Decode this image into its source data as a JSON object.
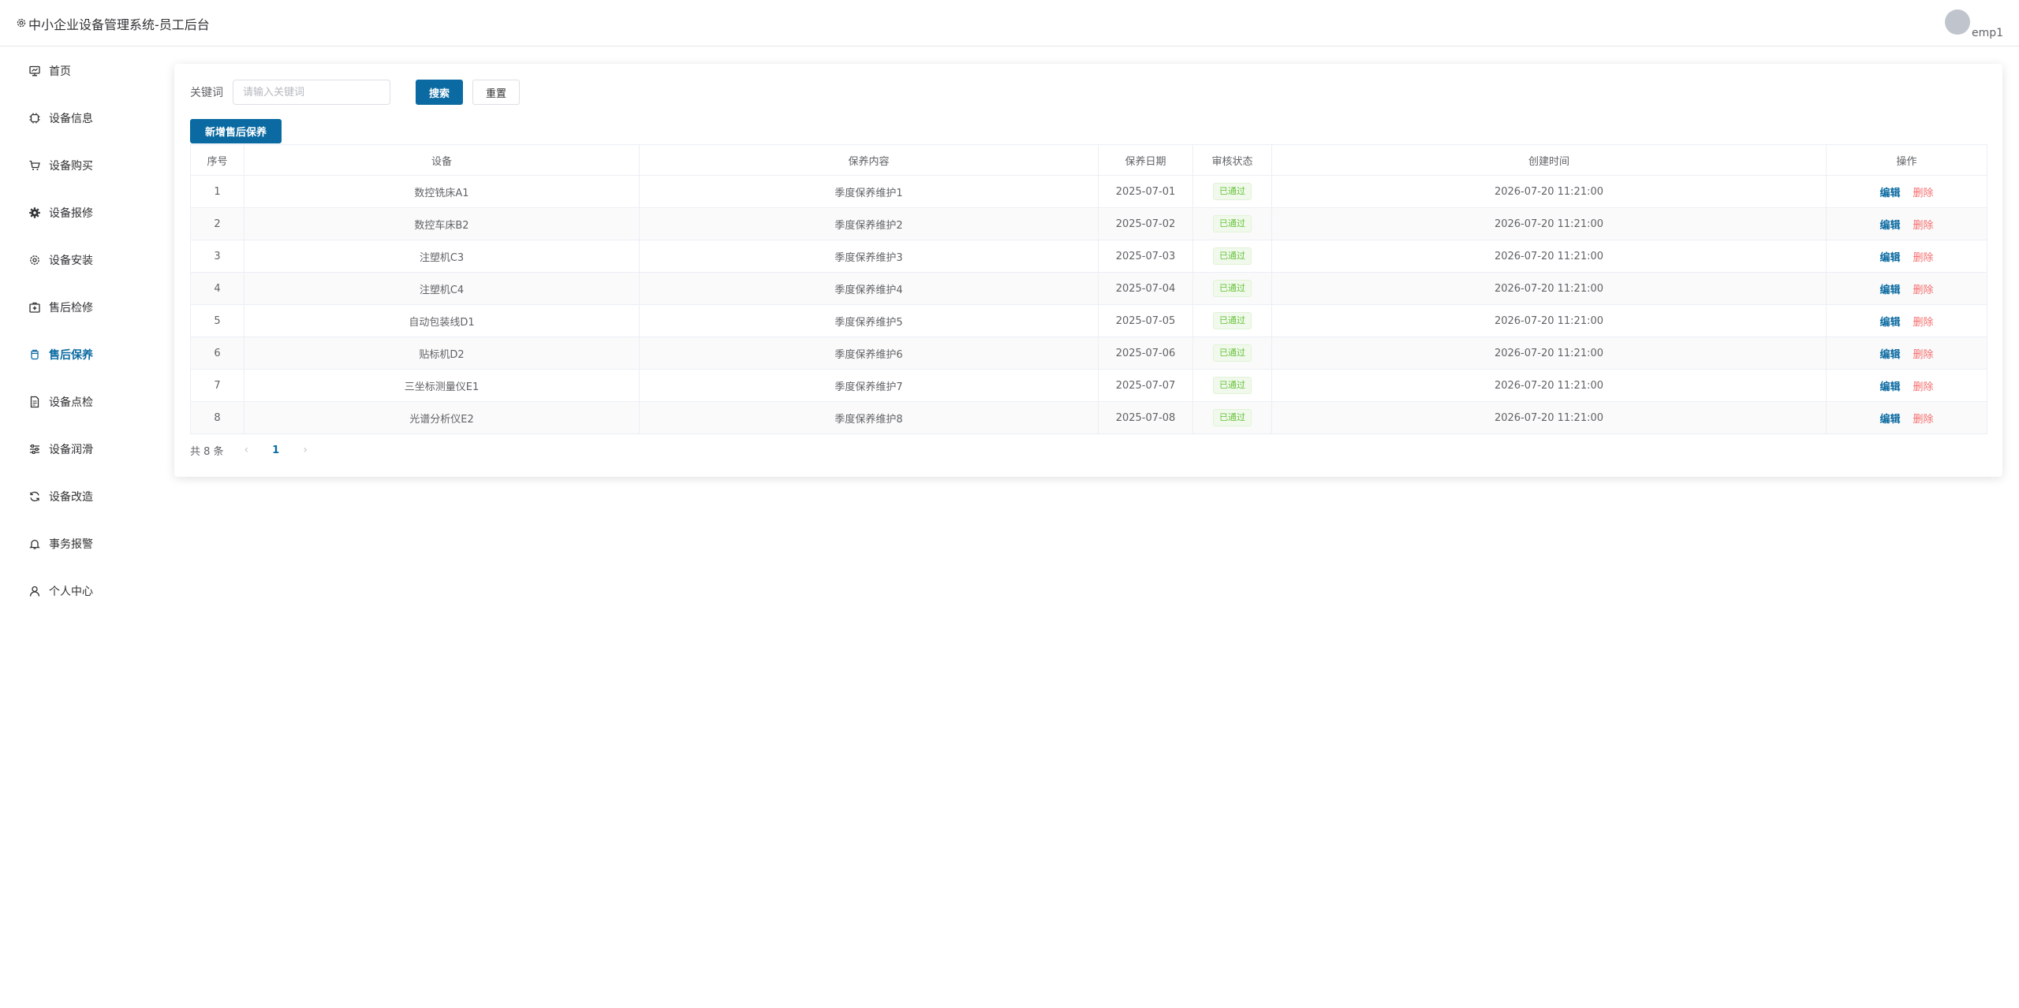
{
  "header": {
    "title": "中小企业设备管理系统-员工后台",
    "username": "emp1"
  },
  "sidebar": {
    "items": [
      {
        "label": "首页",
        "icon": "monitor-icon",
        "active": false
      },
      {
        "label": "设备信息",
        "icon": "cpu-icon",
        "active": false
      },
      {
        "label": "设备购买",
        "icon": "shopping-cart-icon",
        "active": false
      },
      {
        "label": "设备报修",
        "icon": "gear-filled-icon",
        "active": false
      },
      {
        "label": "设备安装",
        "icon": "setting-icon",
        "active": false
      },
      {
        "label": "售后检修",
        "icon": "first-aid-kit-icon",
        "active": false
      },
      {
        "label": "售后保养",
        "icon": "mug-icon",
        "active": true
      },
      {
        "label": "设备点检",
        "icon": "document-icon",
        "active": false
      },
      {
        "label": "设备润滑",
        "icon": "sliders-icon",
        "active": false
      },
      {
        "label": "设备改造",
        "icon": "refresh-icon",
        "active": false
      },
      {
        "label": "事务报警",
        "icon": "bell-icon",
        "active": false
      },
      {
        "label": "个人中心",
        "icon": "user-icon",
        "active": false
      }
    ]
  },
  "search": {
    "label": "关键词",
    "placeholder": "请输入关键词",
    "value": "",
    "search_label": "搜索",
    "reset_label": "重置",
    "add_label": "新增售后保养"
  },
  "table": {
    "columns": [
      "序号",
      "设备",
      "保养内容",
      "保养日期",
      "审核状态",
      "创建时间",
      "操作"
    ],
    "rows": [
      {
        "no": "1",
        "device": "数控铣床A1",
        "content": "季度保养维护1",
        "date": "2025-07-01",
        "status": "已通过",
        "created": "2026-07-20 11:21:00"
      },
      {
        "no": "2",
        "device": "数控车床B2",
        "content": "季度保养维护2",
        "date": "2025-07-02",
        "status": "已通过",
        "created": "2026-07-20 11:21:00"
      },
      {
        "no": "3",
        "device": "注塑机C3",
        "content": "季度保养维护3",
        "date": "2025-07-03",
        "status": "已通过",
        "created": "2026-07-20 11:21:00"
      },
      {
        "no": "4",
        "device": "注塑机C4",
        "content": "季度保养维护4",
        "date": "2025-07-04",
        "status": "已通过",
        "created": "2026-07-20 11:21:00"
      },
      {
        "no": "5",
        "device": "自动包装线D1",
        "content": "季度保养维护5",
        "date": "2025-07-05",
        "status": "已通过",
        "created": "2026-07-20 11:21:00"
      },
      {
        "no": "6",
        "device": "贴标机D2",
        "content": "季度保养维护6",
        "date": "2025-07-06",
        "status": "已通过",
        "created": "2026-07-20 11:21:00"
      },
      {
        "no": "7",
        "device": "三坐标测量仪E1",
        "content": "季度保养维护7",
        "date": "2025-07-07",
        "status": "已通过",
        "created": "2026-07-20 11:21:00"
      },
      {
        "no": "8",
        "device": "光谱分析仪E2",
        "content": "季度保养维护8",
        "date": "2025-07-08",
        "status": "已通过",
        "created": "2026-07-20 11:21:00"
      }
    ],
    "edit_label": "编辑",
    "delete_label": "删除"
  },
  "pagination": {
    "total_text": "共 8 条",
    "current_page": "1",
    "prev_icon": "chevron-left-icon",
    "next_icon": "chevron-right-icon"
  },
  "colors": {
    "primary": "#0a6aa1",
    "danger": "#f56c6c",
    "success": "#67c23a"
  }
}
